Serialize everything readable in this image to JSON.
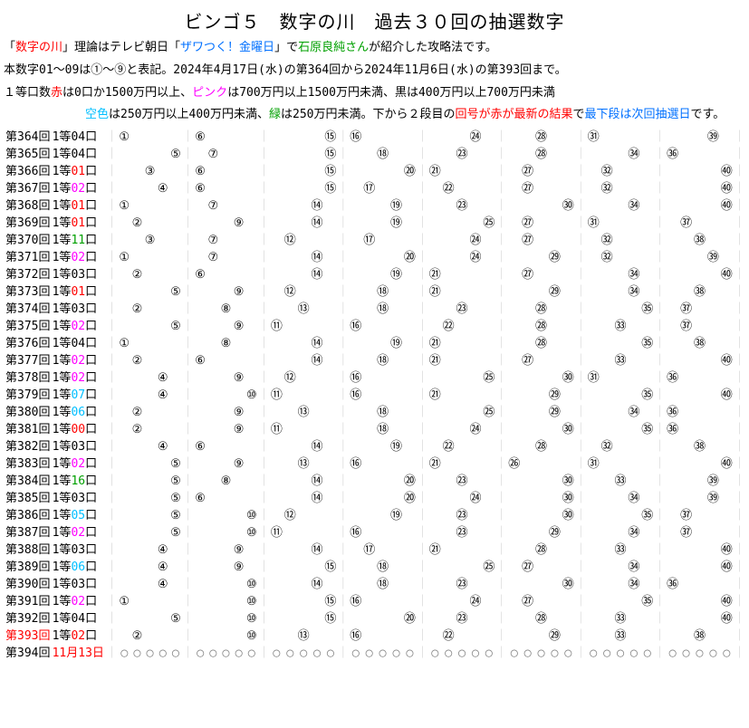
{
  "title": "ビンゴ５　数字の川　過去３０回の抽選数字",
  "intro": {
    "l1a": "「",
    "l1b": "数字の川",
    "l1c": "」理論はテレビ朝日「",
    "l1d": "ザワつく！金曜日",
    "l1e": "」で",
    "l1f": "石原良純さん",
    "l1g": "が紹介した攻略法です。",
    "l2": "本数字01～09は①～⑨と表記。2024年4月17日(水)の第364回から2024年11月6日(水)の第393回まで。",
    "l3a": "１等口数",
    "l3b": "赤",
    "l3c": "は0口か1500万円以上、",
    "l3d": "ピンク",
    "l3e": "は700万円以上1500万円未満、黒は400万円以上700万円未満",
    "l4a": "空色",
    "l4b": "は250万円以上400万円未満、",
    "l4c": "緑",
    "l4d": "は250万円未満。下から２段目の",
    "l4e": "回号が赤が最新の結果",
    "l4f": "で",
    "l4g": "最下段は次回抽選日",
    "l4h": "です。"
  },
  "cols_open": "◯◯◯◯◯",
  "rows": [
    {
      "r": "第364回",
      "p": "1等04口",
      "pc": "black",
      "n": [
        1,
        6,
        15,
        16,
        24,
        28,
        31,
        39
      ]
    },
    {
      "r": "第365回",
      "p": "1等04口",
      "pc": "black",
      "n": [
        5,
        7,
        15,
        18,
        23,
        28,
        34,
        36
      ]
    },
    {
      "r": "第366回",
      "p": "1等01口",
      "pc": "red",
      "n": [
        3,
        6,
        15,
        20,
        21,
        27,
        32,
        40
      ]
    },
    {
      "r": "第367回",
      "p": "1等02口",
      "pc": "pink",
      "n": [
        4,
        6,
        15,
        17,
        22,
        27,
        32,
        40
      ]
    },
    {
      "r": "第368回",
      "p": "1等01口",
      "pc": "red",
      "n": [
        1,
        7,
        14,
        19,
        23,
        30,
        34,
        40
      ]
    },
    {
      "r": "第369回",
      "p": "1等01口",
      "pc": "red",
      "n": [
        2,
        9,
        14,
        19,
        25,
        27,
        31,
        37
      ]
    },
    {
      "r": "第370回",
      "p": "1等11口",
      "pc": "green",
      "n": [
        3,
        7,
        12,
        17,
        24,
        27,
        32,
        38
      ]
    },
    {
      "r": "第371回",
      "p": "1等02口",
      "pc": "pink",
      "n": [
        1,
        7,
        14,
        20,
        24,
        29,
        32,
        39
      ]
    },
    {
      "r": "第372回",
      "p": "1等03口",
      "pc": "black",
      "n": [
        2,
        6,
        14,
        19,
        21,
        27,
        34,
        40
      ]
    },
    {
      "r": "第373回",
      "p": "1等01口",
      "pc": "red",
      "n": [
        5,
        9,
        12,
        18,
        21,
        29,
        34,
        38
      ]
    },
    {
      "r": "第374回",
      "p": "1等03口",
      "pc": "black",
      "n": [
        2,
        8,
        13,
        18,
        23,
        28,
        35,
        37
      ]
    },
    {
      "r": "第375回",
      "p": "1等02口",
      "pc": "pink",
      "n": [
        5,
        9,
        11,
        16,
        22,
        28,
        33,
        37
      ]
    },
    {
      "r": "第376回",
      "p": "1等04口",
      "pc": "black",
      "n": [
        1,
        8,
        14,
        19,
        21,
        28,
        35,
        38
      ]
    },
    {
      "r": "第377回",
      "p": "1等02口",
      "pc": "pink",
      "n": [
        2,
        6,
        14,
        18,
        21,
        27,
        33,
        40
      ]
    },
    {
      "r": "第378回",
      "p": "1等02口",
      "pc": "pink",
      "n": [
        4,
        9,
        12,
        16,
        25,
        30,
        31,
        36
      ]
    },
    {
      "r": "第379回",
      "p": "1等07口",
      "pc": "skyblue",
      "n": [
        4,
        10,
        11,
        16,
        21,
        29,
        35,
        40
      ]
    },
    {
      "r": "第380回",
      "p": "1等06口",
      "pc": "skyblue",
      "n": [
        2,
        9,
        13,
        18,
        25,
        29,
        34,
        36
      ]
    },
    {
      "r": "第381回",
      "p": "1等00口",
      "pc": "red",
      "n": [
        2,
        9,
        11,
        18,
        24,
        30,
        35,
        36
      ]
    },
    {
      "r": "第382回",
      "p": "1等03口",
      "pc": "black",
      "n": [
        4,
        6,
        14,
        19,
        22,
        28,
        32,
        38
      ]
    },
    {
      "r": "第383回",
      "p": "1等02口",
      "pc": "pink",
      "n": [
        5,
        9,
        13,
        16,
        21,
        26,
        31,
        40
      ]
    },
    {
      "r": "第384回",
      "p": "1等16口",
      "pc": "green",
      "n": [
        5,
        8,
        14,
        20,
        23,
        30,
        33,
        39
      ]
    },
    {
      "r": "第385回",
      "p": "1等03口",
      "pc": "black",
      "n": [
        5,
        6,
        14,
        20,
        24,
        30,
        34,
        39
      ]
    },
    {
      "r": "第386回",
      "p": "1等05口",
      "pc": "skyblue",
      "n": [
        5,
        10,
        12,
        19,
        23,
        30,
        35,
        37
      ]
    },
    {
      "r": "第387回",
      "p": "1等02口",
      "pc": "pink",
      "n": [
        5,
        10,
        11,
        16,
        23,
        29,
        34,
        37
      ]
    },
    {
      "r": "第388回",
      "p": "1等03口",
      "pc": "black",
      "n": [
        4,
        9,
        14,
        17,
        21,
        28,
        33,
        40
      ]
    },
    {
      "r": "第389回",
      "p": "1等06口",
      "pc": "skyblue",
      "n": [
        4,
        9,
        15,
        18,
        25,
        27,
        34,
        40
      ]
    },
    {
      "r": "第390回",
      "p": "1等03口",
      "pc": "black",
      "n": [
        4,
        10,
        14,
        18,
        23,
        30,
        34,
        36
      ]
    },
    {
      "r": "第391回",
      "p": "1等02口",
      "pc": "pink",
      "n": [
        1,
        10,
        15,
        16,
        24,
        27,
        35,
        40
      ]
    },
    {
      "r": "第392回",
      "p": "1等04口",
      "pc": "black",
      "n": [
        5,
        10,
        15,
        20,
        23,
        28,
        33,
        40
      ]
    },
    {
      "r": "第393回",
      "p": "1等02口",
      "pc": "pink",
      "red": true,
      "n": [
        2,
        10,
        13,
        16,
        22,
        29,
        33,
        38
      ]
    },
    {
      "r": "第394回",
      "p": "11月13日",
      "pc": "red",
      "last": true
    }
  ],
  "circled": [
    "",
    "①",
    "②",
    "③",
    "④",
    "⑤",
    "⑥",
    "⑦",
    "⑧",
    "⑨",
    "⑩",
    "⑪",
    "⑫",
    "⑬",
    "⑭",
    "⑮",
    "⑯",
    "⑰",
    "⑱",
    "⑲",
    "⑳",
    "㉑",
    "㉒",
    "㉓",
    "㉔",
    "㉕",
    "㉖",
    "㉗",
    "㉘",
    "㉙",
    "㉚",
    "㉛",
    "㉜",
    "㉝",
    "㉞",
    "㉟",
    "㊱",
    "㊲",
    "㊳",
    "㊴",
    "㊵"
  ]
}
